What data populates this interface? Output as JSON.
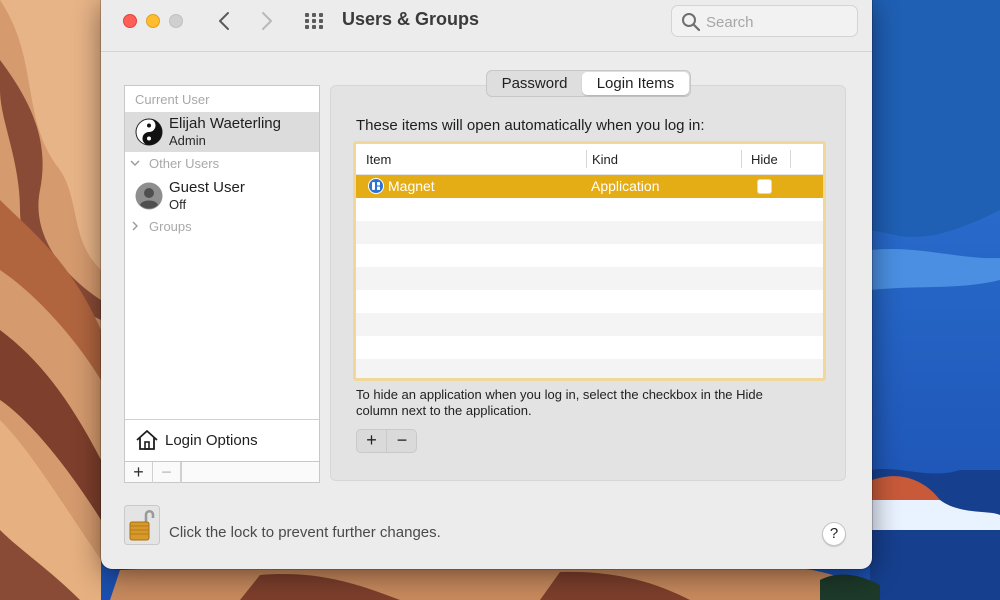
{
  "window": {
    "title": "Users & Groups"
  },
  "search": {
    "placeholder": "Search"
  },
  "sidebar": {
    "current_user_label": "Current User",
    "current_user": {
      "name": "Elijah Waeterling",
      "role": "Admin"
    },
    "other_users_label": "Other Users",
    "guest_user": {
      "name": "Guest User",
      "status": "Off"
    },
    "groups_label": "Groups",
    "login_options_label": "Login Options",
    "add_label": "+",
    "remove_label": "−"
  },
  "tabs": [
    {
      "label": "Password",
      "selected": false
    },
    {
      "label": "Login Items",
      "selected": true
    }
  ],
  "login_items": {
    "intro": "These items will open automatically when you log in:",
    "columns": {
      "item": "Item",
      "kind": "Kind",
      "hide": "Hide"
    },
    "rows": [
      {
        "item": "Magnet",
        "kind": "Application",
        "hide": false,
        "selected": true
      }
    ],
    "help_text": "To hide an application when you log in, select the checkbox in the Hide column next to the application.",
    "add_label": "+",
    "remove_label": "−"
  },
  "lock": {
    "text": "Click the lock to prevent further changes."
  },
  "help_button": {
    "label": "?"
  },
  "colors": {
    "selection": "#e4ad16",
    "table_focus_ring": "#f1d79a",
    "close": "#fe5f57",
    "minimize": "#febc2e"
  }
}
